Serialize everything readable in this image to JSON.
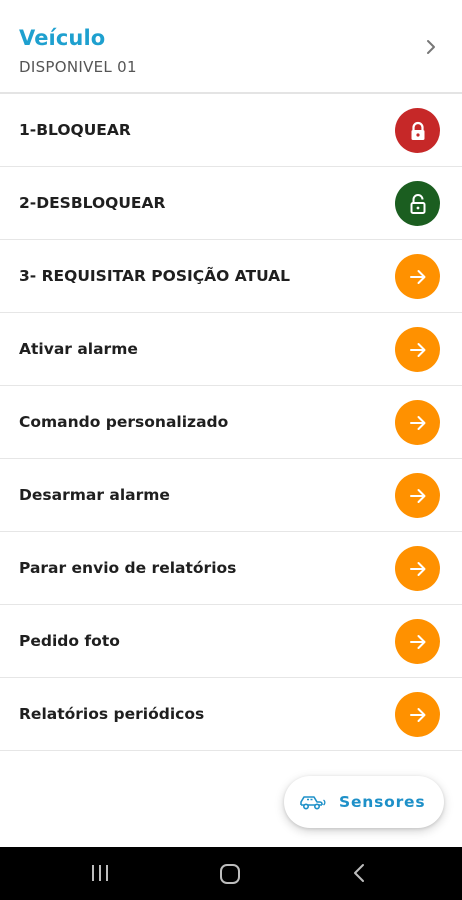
{
  "header": {
    "title": "Veículo",
    "subtitle": "DISPONIVEL 01",
    "chevron_icon": "chevron-right-icon"
  },
  "commands": [
    {
      "label": "1-BLOQUEAR",
      "icon": "lock-icon",
      "color": "#c62828"
    },
    {
      "label": "2-DESBLOQUEAR",
      "icon": "unlock-icon",
      "color": "#1b5e20"
    },
    {
      "label": "3- REQUISITAR POSIÇÃO ATUAL",
      "icon": "arrow-right-icon",
      "color": "#ff9100"
    },
    {
      "label": "Ativar alarme",
      "icon": "arrow-right-icon",
      "color": "#ff9100"
    },
    {
      "label": "Comando personalizado",
      "icon": "arrow-right-icon",
      "color": "#ff9100"
    },
    {
      "label": "Desarmar alarme",
      "icon": "arrow-right-icon",
      "color": "#ff9100"
    },
    {
      "label": "Parar envio de relatórios",
      "icon": "arrow-right-icon",
      "color": "#ff9100"
    },
    {
      "label": "Pedido foto",
      "icon": "arrow-right-icon",
      "color": "#ff9100"
    },
    {
      "label": "Relatórios periódicos",
      "icon": "arrow-right-icon",
      "color": "#ff9100"
    }
  ],
  "fab": {
    "label": "Sensores",
    "icon": "car-sensor-icon"
  },
  "navbar": {
    "items": [
      "recent-apps-icon",
      "home-icon",
      "back-icon"
    ]
  }
}
